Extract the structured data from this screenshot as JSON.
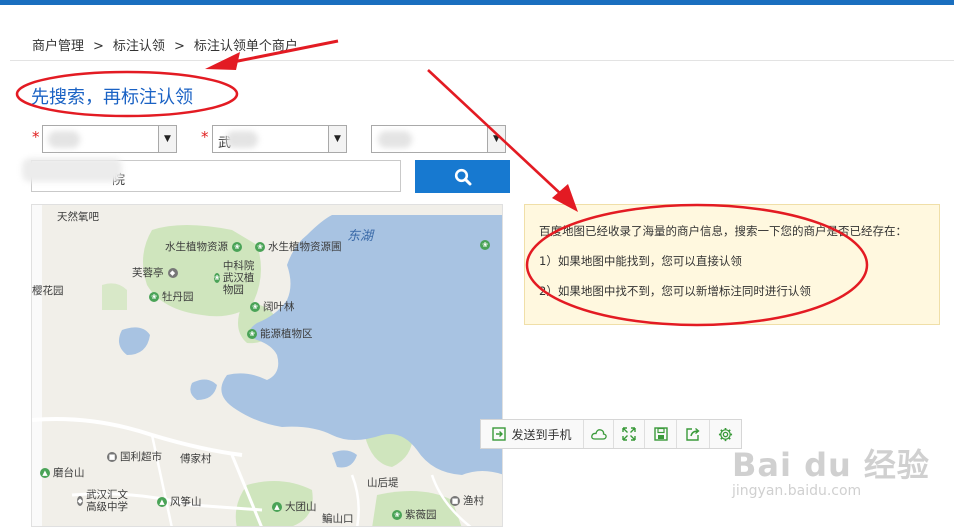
{
  "breadcrumb": {
    "items": [
      "商户管理",
      "标注认领",
      "标注认领单个商户"
    ],
    "separator": ">"
  },
  "page_title": "先搜索，再标注认领",
  "filters": {
    "required_mark": "*",
    "select_1_value": "",
    "select_2_value": "武",
    "select_3_value": "",
    "arrow_glyph": "▼"
  },
  "search": {
    "value": "院",
    "button_icon": "search-icon"
  },
  "map": {
    "lake_label": "东湖",
    "pois": [
      "天然氧吧",
      "水生植物资源",
      "水生植物资源圃",
      "芙蓉亭",
      "中科院武汉植物园",
      "牡丹园",
      "樱花园",
      "阔叶林",
      "能源植物区",
      "国利超市",
      "傅家村",
      "磨台山",
      "武汉汇文高级中学",
      "风筝山",
      "大团山",
      "山后堤",
      "渔村",
      "紫薇园",
      "鳊山口"
    ]
  },
  "info": {
    "line1": "百度地图已经收录了海量的商户信息，搜索一下您的商户是否已经存在：",
    "line2": "1）如果地图中能找到，您可以直接认领",
    "line3": "2）如果地图中找不到，您可以新增标注同时进行认领"
  },
  "toolbar": {
    "send_to_phone": "发送到手机",
    "icons": [
      "cloud-icon",
      "fullscreen-icon",
      "save-icon",
      "share-icon",
      "settings-icon"
    ]
  },
  "watermark": {
    "brand": "Bai du 经验",
    "url": "jingyan.baidu.com"
  },
  "colors": {
    "accent": "#1779d0",
    "title": "#1a62c4",
    "annotation": "#e31b23",
    "info_bg": "#fff8df"
  }
}
